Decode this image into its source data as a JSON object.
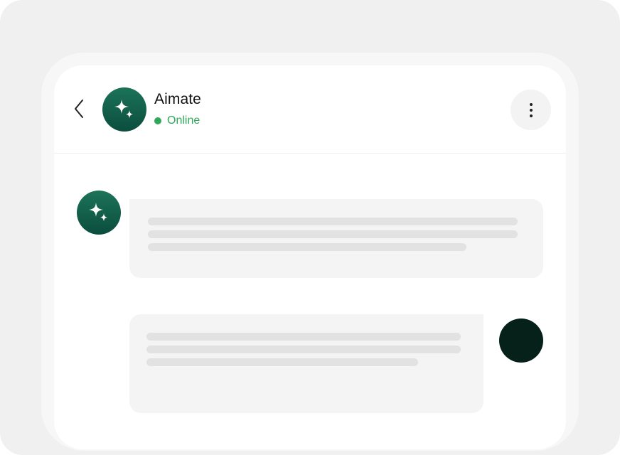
{
  "header": {
    "title": "Aimate",
    "status": "Online",
    "back_icon": "chevron-left-icon",
    "more_icon": "more-vertical-icon",
    "avatar_icon": "sparkle-icon"
  },
  "colors": {
    "brand_gradient_top": "#1c7358",
    "brand_gradient_bottom": "#0b4d3e",
    "online": "#2fa85a",
    "user_avatar": "#062119",
    "bubble": "#f3f4f3",
    "placeholder_line": "#e1e2e1"
  },
  "messages": [
    {
      "sender": "assistant",
      "content": "placeholder",
      "placeholder_lines": 3
    },
    {
      "sender": "user",
      "content": "placeholder",
      "placeholder_lines": 3
    }
  ]
}
